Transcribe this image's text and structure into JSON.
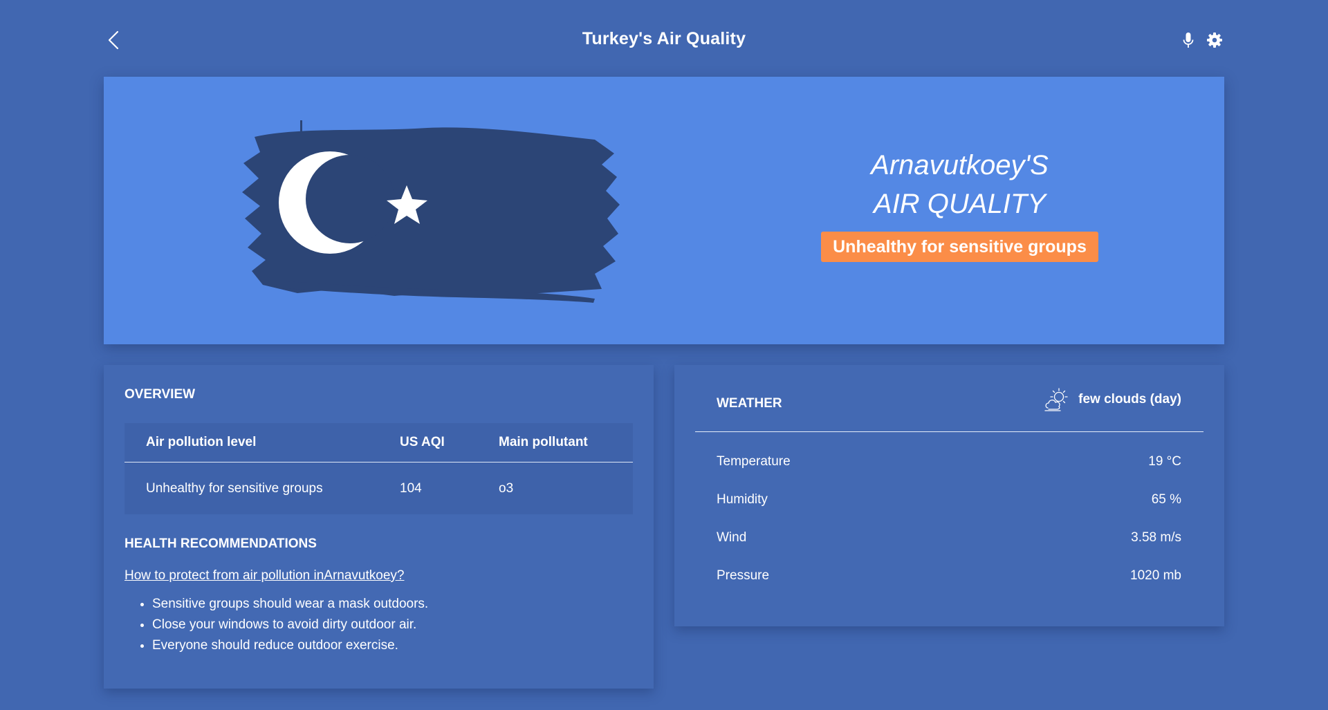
{
  "header": {
    "title": "Turkey's Air Quality",
    "back_icon": "chevron-left-icon",
    "mic_icon": "microphone-icon",
    "settings_icon": "gear-icon"
  },
  "hero": {
    "city_line": "Arnavutkoey'S",
    "aq_line": "AIR QUALITY",
    "badge": "Unhealthy for sensitive groups",
    "badge_color": "#fb8d48",
    "background_color": "#5488e4",
    "flag_icon": "turkey-flag"
  },
  "overview": {
    "title": "OVERVIEW",
    "columns": [
      "Air pollution level",
      "US AQI",
      "Main pollutant"
    ],
    "rows": [
      [
        "Unhealthy for sensitive groups",
        "104",
        "o3"
      ]
    ]
  },
  "health": {
    "title": "HEALTH RECOMMENDATIONS",
    "link": "How to protect from air pollution inArnavutkoey?",
    "items": [
      "Sensitive groups should wear a mask outdoors.",
      "Close your windows to avoid dirty outdoor air.",
      "Everyone should reduce outdoor exercise."
    ]
  },
  "weather": {
    "title": "WEATHER",
    "condition": "few clouds (day)",
    "condition_icon": "partly-cloudy-icon",
    "rows": [
      {
        "label": "Temperature",
        "value": "19 °C"
      },
      {
        "label": "Humidity",
        "value": "65 %"
      },
      {
        "label": "Wind",
        "value": "3.58 m/s"
      },
      {
        "label": "Pressure",
        "value": "1020 mb"
      }
    ]
  },
  "colors": {
    "page_background": "#4167b1",
    "card_background": "#4369b3"
  }
}
